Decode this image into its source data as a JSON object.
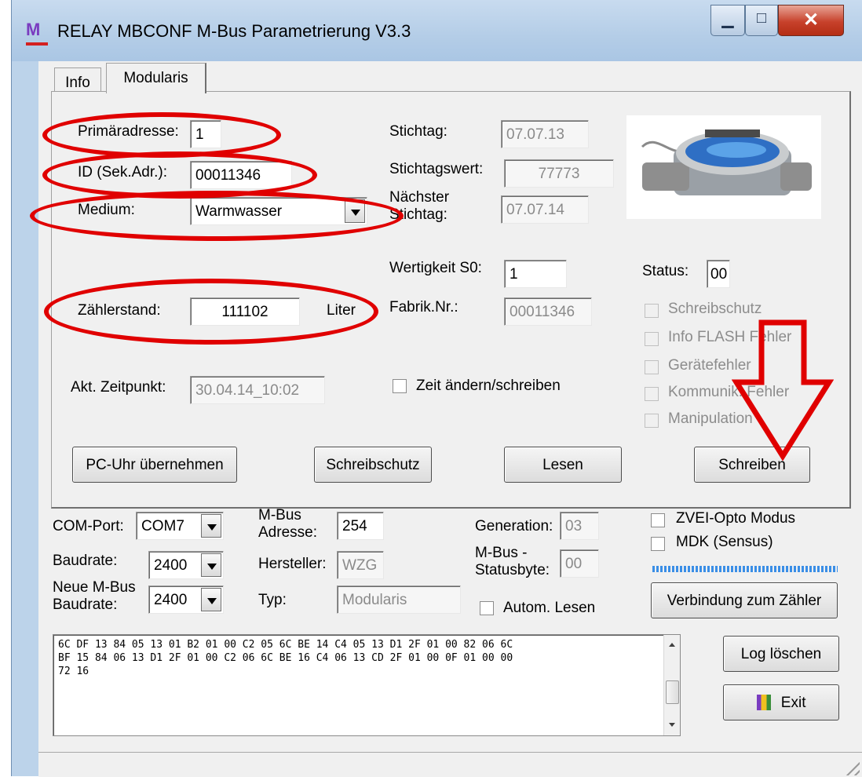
{
  "window": {
    "title": "RELAY MBCONF  M-Bus Parametrierung  V3.3",
    "logo": "M"
  },
  "tabs": [
    {
      "label": "Info"
    },
    {
      "label": "Modularis"
    }
  ],
  "fields": {
    "primaeradresse": {
      "label": "Primäradresse:",
      "value": "1"
    },
    "id": {
      "label": "ID (Sek.Adr.):",
      "value": "00011346"
    },
    "medium": {
      "label": "Medium:",
      "value": "Warmwasser"
    },
    "zaehlerstand": {
      "label": "Zählerstand:",
      "value": "111102",
      "unit": "Liter"
    },
    "akt_zeitpunkt": {
      "label": "Akt. Zeitpunkt:",
      "value": "30.04.14_10:02"
    },
    "stichtag": {
      "label": "Stichtag:",
      "value": "07.07.13"
    },
    "stichtagswert": {
      "label": "Stichtagswert:",
      "value": "77773"
    },
    "naechster_stichtag": {
      "label_1": "Nächster",
      "label_2": "Stichtag:",
      "value": "07.07.14"
    },
    "wertigkeit_s0": {
      "label": "Wertigkeit S0:",
      "value": "1"
    },
    "fabrik_nr": {
      "label": "Fabrik.Nr.:",
      "value": "00011346"
    },
    "status": {
      "label": "Status:",
      "value": "00"
    }
  },
  "status_checks": [
    "Schreibschutz",
    "Info FLASH Fehler",
    "Gerätefehler",
    "Kommunik. Fehler",
    "Manipulation"
  ],
  "zeit_check": "Zeit ändern/schreiben",
  "tab_buttons": {
    "pc_uhr": "PC-Uhr übernehmen",
    "schreibschutz": "Schreibschutz",
    "lesen": "Lesen",
    "schreiben": "Schreiben"
  },
  "conn": {
    "com_port_label": "COM-Port:",
    "com_port_value": "COM7",
    "baudrate_label": "Baudrate:",
    "baudrate_value": "2400",
    "neue_baud_label_1": "Neue M-Bus",
    "neue_baud_label_2": "Baudrate:",
    "neue_baud_value": "2400",
    "mbus_adr_label_1": "M-Bus",
    "mbus_adr_label_2": "Adresse:",
    "mbus_adr_value": "254",
    "hersteller_label": "Hersteller:",
    "hersteller_value": "WZG",
    "typ_label": "Typ:",
    "typ_value": "Modularis",
    "generation_label": "Generation:",
    "generation_value": "03",
    "statusbyte_label_1": "M-Bus -",
    "statusbyte_label_2": "Statusbyte:",
    "statusbyte_value": "00",
    "autom_lesen": "Autom. Lesen",
    "zvei_opto": "ZVEI-Opto Modus",
    "mdk": "MDK (Sensus)",
    "verbindung": "Verbindung zum Zähler",
    "log_loeschen": "Log löschen",
    "exit": "Exit"
  },
  "log_lines": [
    "6C DF 13 84 05 13 01 B2 01 00 C2 05 6C BE 14 C4 05 13 D1 2F 01 00 82 06 6C",
    "BF 15 84 06 13 D1 2F 01 00 C2 06 6C BE 16 C4 06 13 CD 2F 01 00 0F 01 00 00",
    "72 16"
  ],
  "colors": {
    "annotation": "#e00000",
    "progress": "#3a8ee6",
    "titlebar": "#bcd3ea"
  }
}
